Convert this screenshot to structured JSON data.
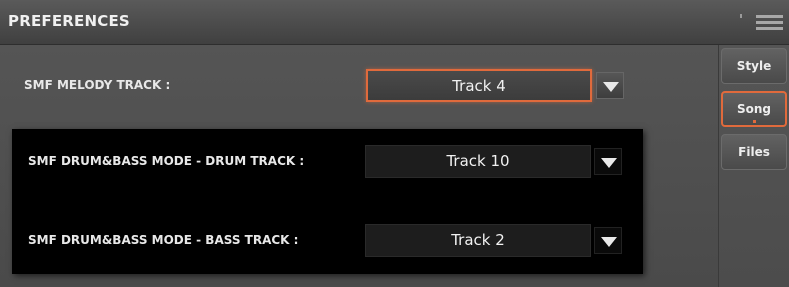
{
  "header": {
    "title": "PREFERENCES",
    "icon": "menu-icon"
  },
  "settings": [
    {
      "label": "SMF MELODY TRACK :",
      "value": "Track 4"
    },
    {
      "label": "SMF DRUM&BASS MODE - DRUM TRACK :",
      "value": "Track 10"
    },
    {
      "label": "SMF DRUM&BASS MODE - BASS TRACK :",
      "value": "Track 2"
    }
  ],
  "sidebar": {
    "tabs": [
      {
        "label": "Style",
        "active": false
      },
      {
        "label": "Song",
        "active": true
      },
      {
        "label": "Files",
        "active": false
      }
    ]
  },
  "colors": {
    "accent": "#e06a3c",
    "background": "#4d4d4d",
    "panel": "#000000"
  }
}
